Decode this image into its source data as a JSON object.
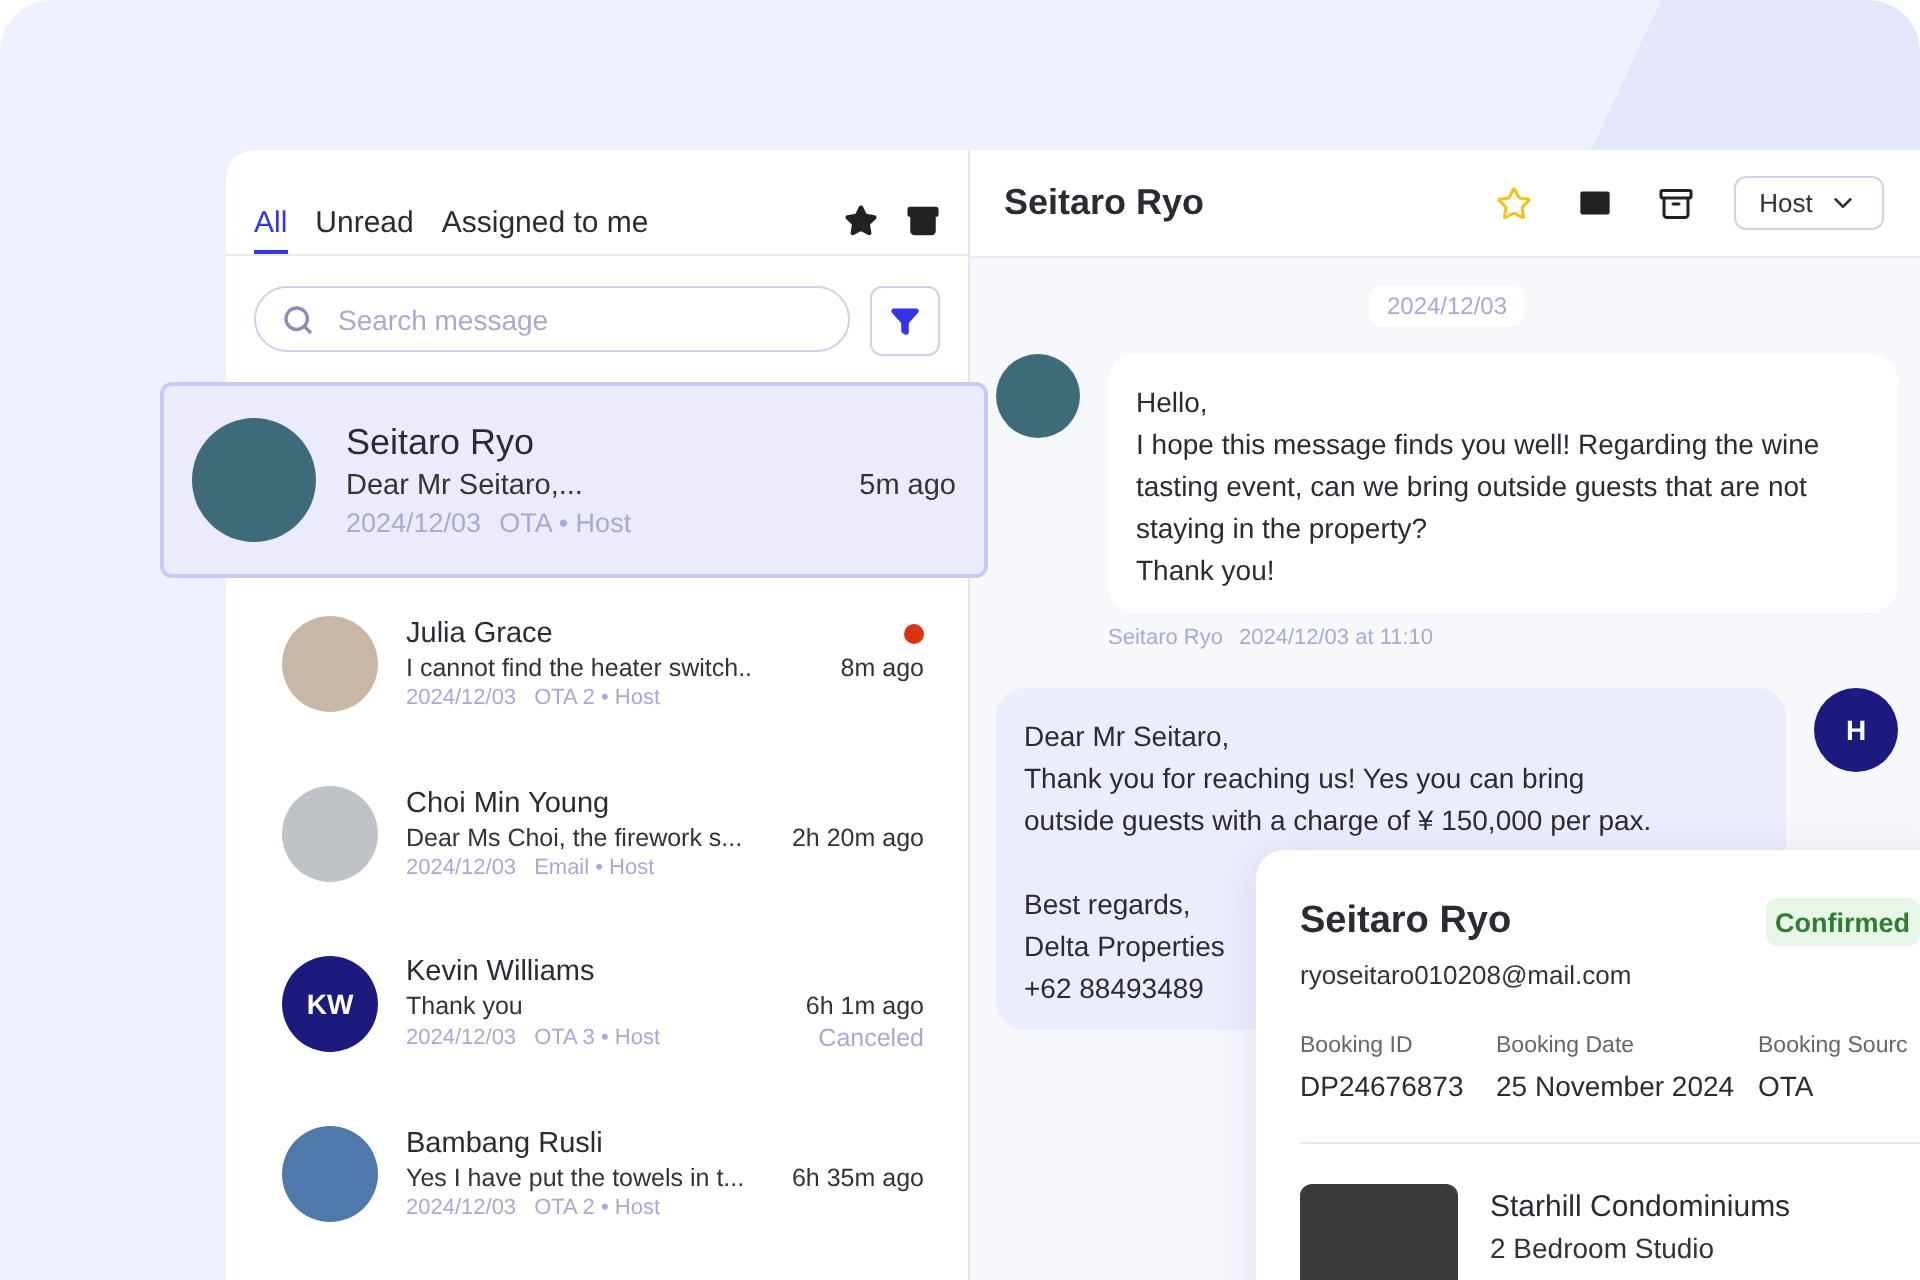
{
  "conversation_list": {
    "tabs": [
      {
        "label": "All",
        "selected": true
      },
      {
        "label": "Unread",
        "selected": false
      },
      {
        "label": "Assigned to me",
        "selected": false
      }
    ],
    "search": {
      "placeholder": "Search message"
    },
    "conversations": [
      {
        "kind": "photo",
        "name": "Seitaro Ryo",
        "preview": "Dear Mr Seitaro,...",
        "time": "5m ago",
        "date": "2024/12/03",
        "channel": "OTA • Host",
        "selected": true,
        "unread": false
      },
      {
        "kind": "photo",
        "name": "Julia Grace",
        "preview": "I cannot find the heater switch..",
        "time": "8m ago",
        "date": "2024/12/03",
        "channel": "OTA 2 • Host",
        "selected": false,
        "unread": true
      },
      {
        "kind": "photo",
        "name": "Choi Min Young",
        "preview": "Dear Ms Choi, the firework s...",
        "time": "2h 20m ago",
        "date": "2024/12/03",
        "channel": "Email • Host",
        "selected": false,
        "unread": false
      },
      {
        "kind": "initials",
        "initials": "KW",
        "name": "Kevin Williams",
        "preview": "Thank you",
        "time": "6h 1m ago",
        "date": "2024/12/03",
        "channel": "OTA 3 • Host",
        "status": "Canceled",
        "selected": false,
        "unread": false
      },
      {
        "kind": "photo",
        "name": "Bambang Rusli",
        "preview": "Yes I have put the towels in t...",
        "time": "6h 35m ago",
        "date": "2024/12/03",
        "channel": "OTA 2 • Host",
        "selected": false,
        "unread": false
      }
    ]
  },
  "chat": {
    "title": "Seitaro Ryo",
    "role_select": "Host",
    "date_divider": "2024/12/03",
    "messages": [
      {
        "kind": "incoming",
        "text": "Hello,\nI hope this message finds you well! Regarding the wine tasting event, can we bring outside guests that are not staying in the property?\nThank you!",
        "sender": "Seitaro Ryo",
        "timestamp": "2024/12/03 at 11:10"
      },
      {
        "kind": "outgoing",
        "initials": "H",
        "text": "Dear Mr Seitaro,\nThank you for reaching us! Yes you can bring outside guests with a charge of ¥ 150,000 per pax.\n\nBest regards,\nDelta Properties\n+62 88493489"
      }
    ]
  },
  "booking_card": {
    "guest_name": "Seitaro Ryo",
    "email": "ryoseitaro010208@mail.com",
    "status": "Confirmed",
    "fields": [
      {
        "label": "Booking ID",
        "value": "DP24676873"
      },
      {
        "label": "Booking Date",
        "value": "25 November 2024"
      },
      {
        "label": "Booking Sourc",
        "value": "OTA"
      }
    ],
    "property": {
      "name": "Starhill Condominiums",
      "unit": "2 Bedroom Studio"
    }
  }
}
